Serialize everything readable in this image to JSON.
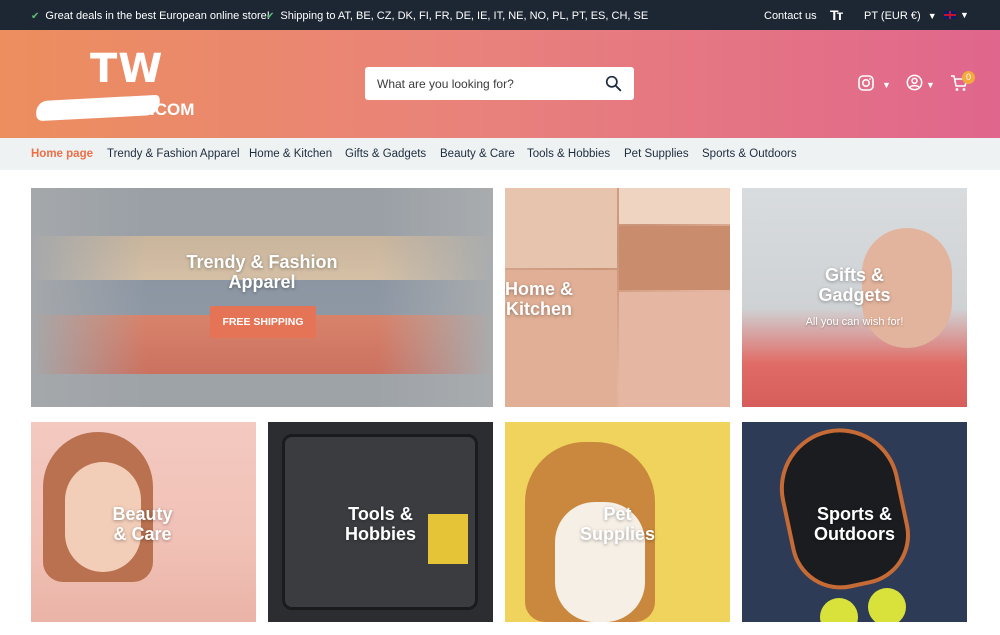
{
  "topbar": {
    "message_1": "Great deals in the best European online store!",
    "message_2": "Shipping to AT, BE, CZ, DK, FI, FR, DE, IE, IT, NE, NO, PL, PT, ES, CH, SE",
    "contact": "Contact us",
    "text_size_icon": "Tт",
    "currency": "PT (EUR €)",
    "language_flag": "uk-flag-icon"
  },
  "header": {
    "logo_text": "TW",
    "logo_suffix": ".COM",
    "search_placeholder": "What are you looking for?",
    "cart_count": "0",
    "icons": [
      "instagram-icon",
      "account-icon",
      "cart-icon",
      "search-icon"
    ]
  },
  "nav": {
    "items": [
      "Home page",
      "Trendy & Fashion Apparel",
      "Home & Kitchen",
      "Gifts & Gadgets",
      "Beauty & Care",
      "Tools & Hobbies",
      "Pet Supplies",
      "Sports & Outdoors"
    ],
    "active_index": 0
  },
  "tiles": {
    "trendy": {
      "title": "Trendy & Fashion\nApparel",
      "button": "FREE SHIPPING"
    },
    "home": {
      "title": "Home &\nKitchen"
    },
    "gifts": {
      "title": "Gifts &\nGadgets",
      "subtitle": "All you can wish for!"
    },
    "beauty": {
      "title": "Beauty\n& Care"
    },
    "tools": {
      "title": "Tools &\nHobbies"
    },
    "pet": {
      "title": "Pet\nSupplies"
    },
    "sports": {
      "title": "Sports &\nOutdoors"
    }
  },
  "colors": {
    "topbar_bg": "#1d2733",
    "header_gradient_start": "#ec8e5e",
    "header_gradient_end": "#e0668d",
    "nav_bg": "#eef2f3",
    "nav_active": "#ec6f46",
    "button_bg": "#e57356",
    "cart_badge": "#f3a93b"
  }
}
